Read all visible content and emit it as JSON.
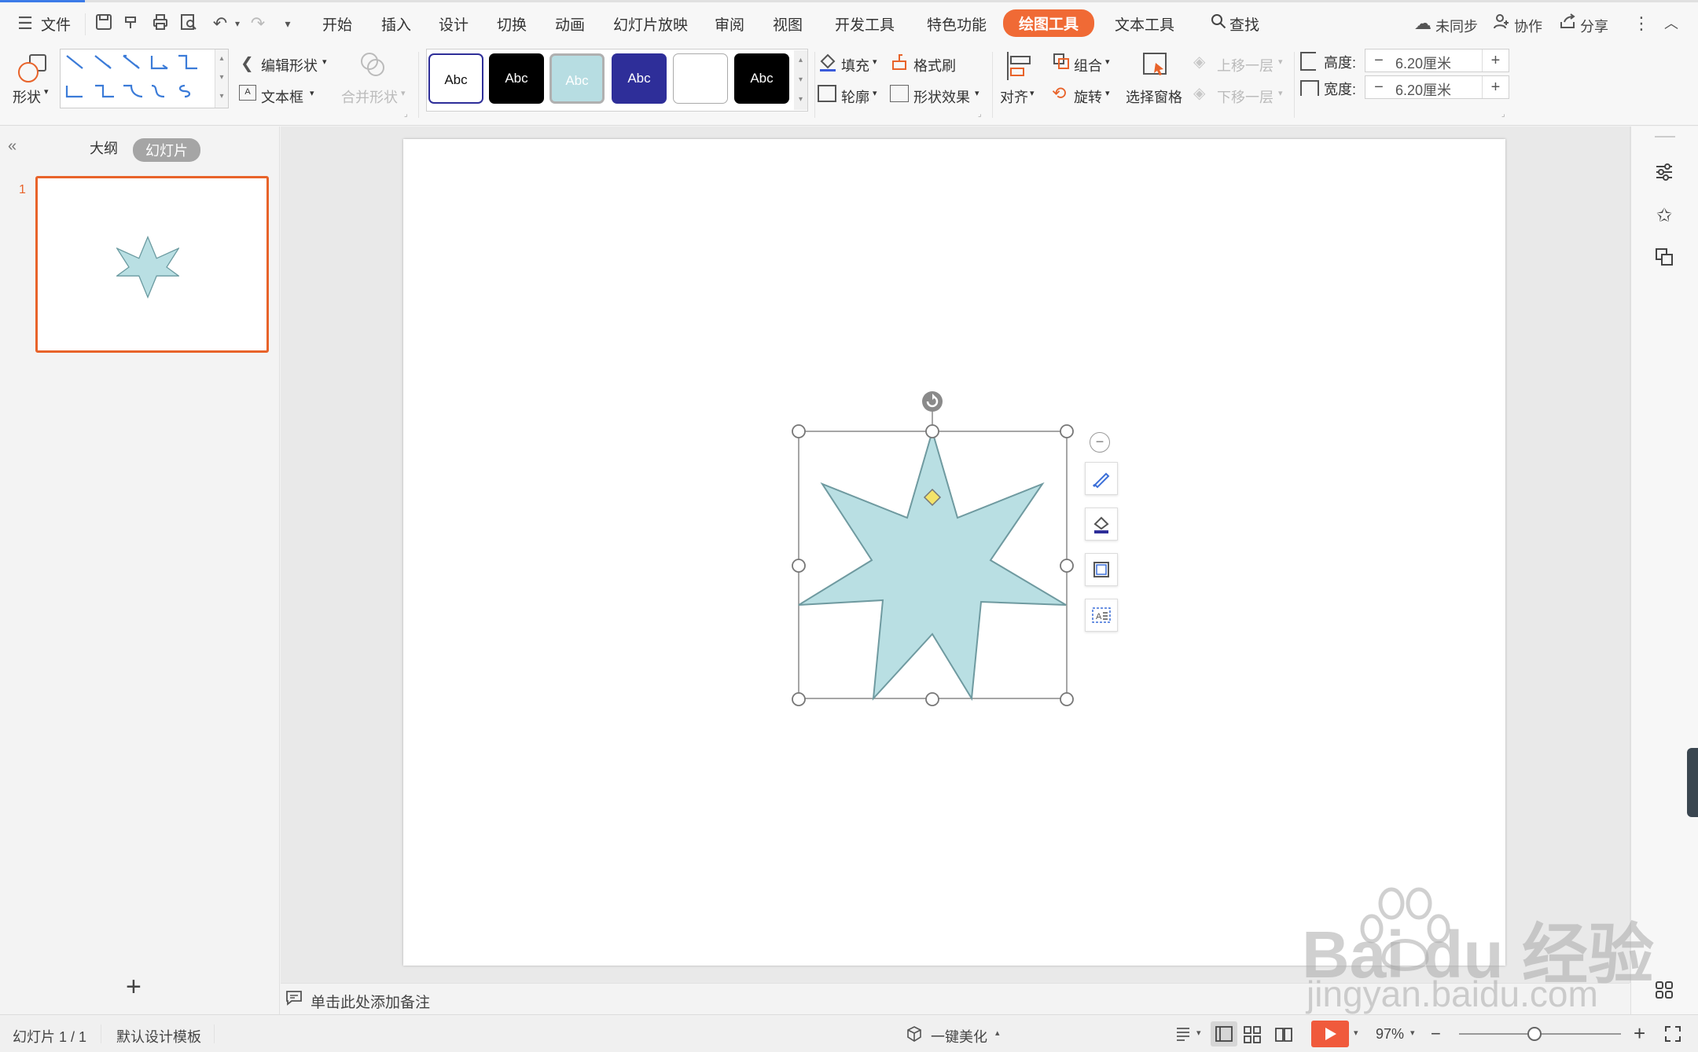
{
  "menu": {
    "file": "文件",
    "tabs": [
      "开始",
      "插入",
      "设计",
      "切换",
      "动画",
      "幻灯片放映",
      "审阅",
      "视图",
      "开发工具",
      "特色功能",
      "绘图工具",
      "文本工具"
    ],
    "active_tab": "绘图工具",
    "search": "查找",
    "right": {
      "sync": "未同步",
      "collab": "协作",
      "share": "分享"
    }
  },
  "ribbon": {
    "shape": "形状",
    "edit_shape": "编辑形状",
    "text_box": "文本框",
    "merge_shape": "合并形状",
    "style_sample": "Abc",
    "fill": "填充",
    "format_painter": "格式刷",
    "outline": "轮廓",
    "shape_effects": "形状效果",
    "align": "对齐",
    "group": "组合",
    "rotate": "旋转",
    "selection_pane": "选择窗格",
    "bring_forward": "上移一层",
    "send_backward": "下移一层",
    "height_label": "高度:",
    "height_value": "6.20厘米",
    "width_label": "宽度:",
    "width_value": "6.20厘米",
    "minus": "−",
    "plus": "+"
  },
  "colors": {
    "accent_orange": "#f06a35",
    "star_fill": "#b9dfe3",
    "style_teal": "#b7dde2",
    "style_navy": "#2e2e99",
    "play_red": "#f05a3c"
  },
  "left_panel": {
    "tab_outline": "大纲",
    "tab_slides": "幻灯片",
    "slide_number": "1",
    "add_symbol": "+"
  },
  "notes": {
    "placeholder": "单击此处添加备注"
  },
  "status": {
    "slide_counter": "幻灯片 1 / 1",
    "template": "默认设计模板",
    "beautify": "一键美化",
    "zoom": "97%"
  },
  "watermark": {
    "brand": "Bai  du 经验",
    "url": "jingyan.baidu.com"
  }
}
